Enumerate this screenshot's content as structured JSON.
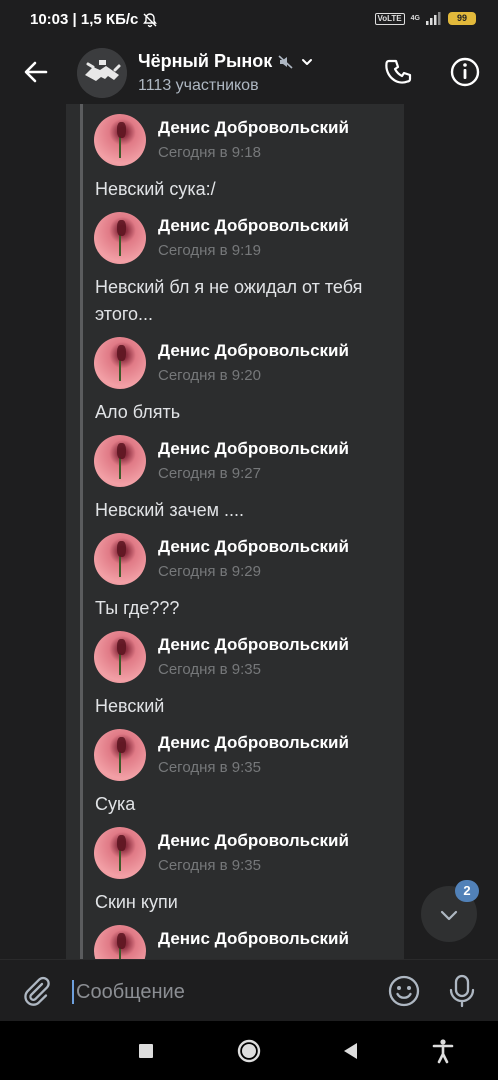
{
  "status_bar": {
    "time_speed": "10:03 | 1,5 КБ/с",
    "volte": "VoLTE",
    "network": "4G",
    "battery": "99"
  },
  "header": {
    "title": "Чёрный Рынок",
    "subtitle": "1113 участников"
  },
  "messages": [
    {
      "author": "Денис Добровольский",
      "time": "Сегодня в 9:18",
      "text": "Невский сука:/"
    },
    {
      "author": "Денис Добровольский",
      "time": "Сегодня в 9:19",
      "text": "Невский бл я не ожидал от тебя этого..."
    },
    {
      "author": "Денис Добровольский",
      "time": "Сегодня в 9:20",
      "text": "Ало блять"
    },
    {
      "author": "Денис Добровольский",
      "time": "Сегодня в 9:27",
      "text": "Невский зачем ...."
    },
    {
      "author": "Денис Добровольский",
      "time": "Сегодня в 9:29",
      "text": "Ты где???"
    },
    {
      "author": "Денис Добровольский",
      "time": "Сегодня в 9:35",
      "text": "Невский"
    },
    {
      "author": "Денис Добровольский",
      "time": "Сегодня в 9:35",
      "text": "Сука"
    },
    {
      "author": "Денис Добровольский",
      "time": "Сегодня в 9:35",
      "text": "Скин купи"
    },
    {
      "author": "Денис Добровольский",
      "time": "",
      "text": ""
    }
  ],
  "scroll_fab": {
    "badge": "2"
  },
  "composer": {
    "placeholder": "Сообщение"
  },
  "colors": {
    "accent": "#5181b8",
    "background": "#1e1e1f",
    "bubble": "#2c2d2e"
  }
}
